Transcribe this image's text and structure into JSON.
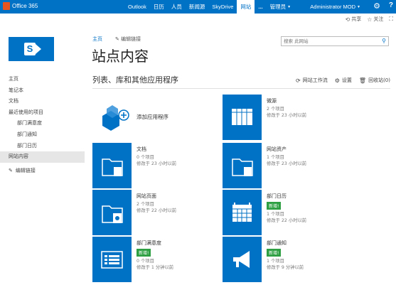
{
  "suite": {
    "product": "Office 365",
    "nav": [
      "Outlook",
      "日历",
      "人员",
      "新闻源",
      "SkyDrive",
      "网站",
      "...",
      "管理员"
    ],
    "user": "Administrator MOD",
    "settings_icon": "gear-icon",
    "help_label": "?"
  },
  "actions": {
    "share": "共享",
    "follow": "关注"
  },
  "site": {
    "logo_letter": "S",
    "breadcrumb_home": "主页",
    "breadcrumb_edit": "编辑链接",
    "title": "站点内容",
    "search_placeholder": "搜索 此网站"
  },
  "leftnav": [
    {
      "label": "主页",
      "sub": false,
      "selected": false
    },
    {
      "label": "笔记本",
      "sub": false,
      "selected": false
    },
    {
      "label": "文档",
      "sub": false,
      "selected": false
    },
    {
      "label": "最近使用的项目",
      "sub": false,
      "selected": false
    },
    {
      "label": "部门满意度",
      "sub": true,
      "selected": false
    },
    {
      "label": "部门通知",
      "sub": true,
      "selected": false
    },
    {
      "label": "部门日历",
      "sub": true,
      "selected": false
    },
    {
      "label": "网站内容",
      "sub": false,
      "selected": true
    }
  ],
  "leftnav_edit": "编辑链接",
  "section": {
    "title": "列表、库和其他应用程序",
    "workflows": "网站工作流",
    "settings": "设置",
    "recycle_bin": "回收站(0)"
  },
  "tiles": [
    {
      "name": "添加应用程序",
      "kind": "add"
    },
    {
      "name": "微源",
      "count": "2 个项目",
      "modified": "修改于 23 小时以前",
      "icon": "table-icon"
    },
    {
      "name": "文档",
      "count": "0 个项目",
      "modified": "修改于 23 小时以前",
      "icon": "folder-icon"
    },
    {
      "name": "网站资产",
      "count": "1 个项目",
      "modified": "修改于 23 小时以前",
      "icon": "folder-icon"
    },
    {
      "name": "网站页面",
      "count": "2 个项目",
      "modified": "修改于 22 小时以前",
      "icon": "folder-pages-icon"
    },
    {
      "name": "部门日历",
      "badge": "新增!",
      "count": "1 个项目",
      "modified": "修改于 22 小时以前",
      "icon": "calendar-icon"
    },
    {
      "name": "部门满意度",
      "badge": "新增!",
      "count": "0 个项目",
      "modified": "修改于 1 分钟以前",
      "icon": "survey-icon"
    },
    {
      "name": "部门通知",
      "badge": "新增!",
      "count": "1 个项目",
      "modified": "修改于 9 分钟以前",
      "icon": "megaphone-icon"
    }
  ],
  "colors": {
    "brand": "#0072c6",
    "badge": "#2ea043"
  }
}
